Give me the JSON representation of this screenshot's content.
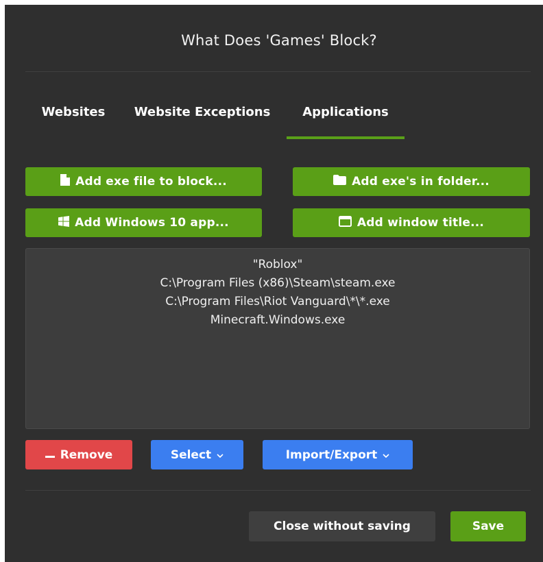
{
  "dialog": {
    "title": "What Does 'Games' Block?"
  },
  "tabs": [
    {
      "label": "Websites",
      "active": false
    },
    {
      "label": "Website Exceptions",
      "active": false
    },
    {
      "label": "Applications",
      "active": true
    }
  ],
  "actions": {
    "add_exe_label": "Add exe file to block...",
    "add_folder_label": "Add exe's in folder...",
    "add_win10_label": "Add Windows 10 app...",
    "add_window_title_label": "Add window title..."
  },
  "blocked_items": [
    "\"Roblox\"",
    "C:\\Program Files (x86)\\Steam\\steam.exe",
    "C:\\Program Files\\Riot Vanguard\\*\\*.exe",
    "Minecraft.Windows.exe"
  ],
  "list_controls": {
    "remove_label": "Remove",
    "select_label": "Select",
    "import_export_label": "Import/Export"
  },
  "footer": {
    "close_label": "Close without saving",
    "save_label": "Save"
  },
  "colors": {
    "accent_green": "#5a9f17",
    "danger_red": "#e14749",
    "primary_blue": "#3b7ef0",
    "dialog_bg": "#2f2f2f"
  },
  "icons": {
    "add_exe": "file-icon",
    "add_folder": "folder-icon",
    "add_win10": "windows-icon",
    "add_window_title": "window-icon",
    "remove": "minus-icon",
    "select": "chevron-down-icon",
    "import_export": "chevron-down-icon"
  }
}
